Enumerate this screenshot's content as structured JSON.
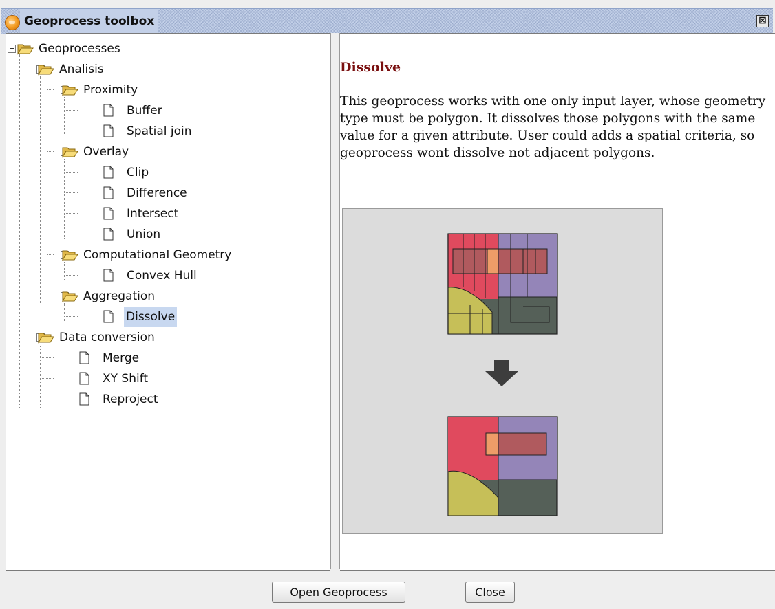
{
  "window": {
    "title": "Geoprocess toolbox",
    "close_glyph": "⊠",
    "app_icon": "gvsig-icon",
    "accent_color": "#7a1010",
    "selection_color": "#c8d8f0"
  },
  "tree": {
    "root": "Geoprocesses",
    "analisis": "Analisis",
    "proximity": "Proximity",
    "buffer": "Buffer",
    "spatial_join": "Spatial join",
    "overlay": "Overlay",
    "clip": "Clip",
    "difference": "Difference",
    "intersect": "Intersect",
    "union": "Union",
    "computational_geometry": "Computational Geometry",
    "convex_hull": "Convex Hull",
    "aggregation": "Aggregation",
    "dissolve": "Dissolve",
    "data_conversion": "Data conversion",
    "merge": "Merge",
    "xy_shift": "XY Shift",
    "reproject": "Reproject",
    "selected": "Dissolve"
  },
  "description": {
    "title": "Dissolve",
    "body": "This geoprocess works with one only input layer, whose geometry type must be polygon. It dissolves those polygons with the same value for a given attribute. User could adds a spatial criteria, so geoprocess wont dissolve not adjacent polygons.",
    "illustration_colors": {
      "red": "#e04a5e",
      "purple": "#9485b8",
      "olive": "#c6bf58",
      "dark": "#556058",
      "orange": "#ee9c68",
      "brownred": "#b05a5e"
    }
  },
  "buttons": {
    "open": "Open Geoprocess",
    "close": "Close"
  }
}
